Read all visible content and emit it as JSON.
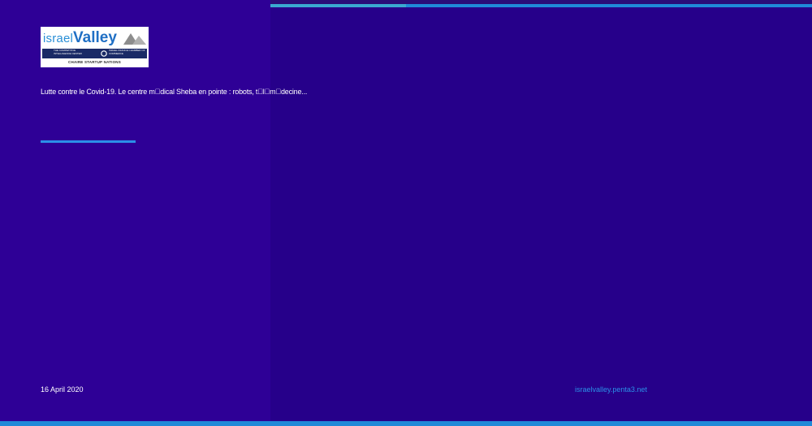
{
  "logo": {
    "word_israel": "israel",
    "word_valley": "Valley",
    "strip_left_text": "THE COMPETITIVE INTELLIGENCE CENTER",
    "strip_right_text": "ISRAEL FRANCE CHAMBER OF COMMERCE",
    "caption": "CHAIRE STARTUP NATIONS"
  },
  "article": {
    "headline": "Lutte contre le Covid-19. Le centre m\u0000dical Sheba en pointe : robots, t\u0000l\u0000m\u0000decine...",
    "date": "16 April 2020"
  },
  "footer": {
    "site": "israelvalley.penta3.net"
  },
  "colors": {
    "background": "#26008a",
    "left_panel": "#2e0096",
    "accent_blue": "#1f8ad8",
    "link_blue": "#2b8fe8"
  }
}
